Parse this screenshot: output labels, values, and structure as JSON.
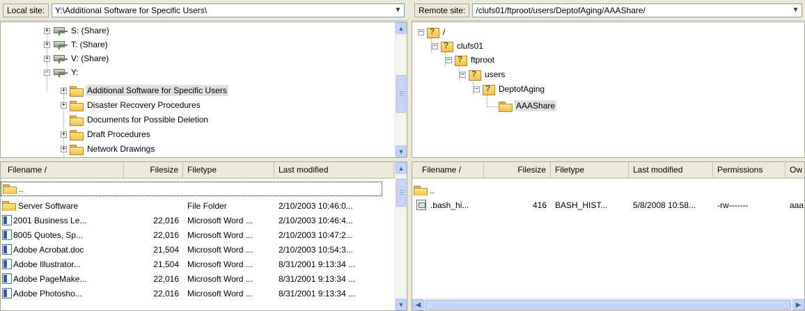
{
  "local": {
    "label": "Local site:",
    "path": "Y:\\Additional Software for Specific Users\\",
    "tree": [
      {
        "label": "S: (Share)",
        "type": "share",
        "expander": "+"
      },
      {
        "label": "T: (Share)",
        "type": "share",
        "expander": "+"
      },
      {
        "label": "V: (Share)",
        "type": "share",
        "expander": "+"
      },
      {
        "label": "Y:",
        "type": "share",
        "expander": "−"
      },
      {
        "label": "Additional Software for Specific Users",
        "type": "folder",
        "expander": "+",
        "selected": true
      },
      {
        "label": "Disaster Recovery Procedures",
        "type": "folder",
        "expander": "+"
      },
      {
        "label": "Documents for Possible Deletion",
        "type": "folder",
        "expander": ""
      },
      {
        "label": "Draft Procedures",
        "type": "folder",
        "expander": "+"
      },
      {
        "label": "Network Drawings",
        "type": "folder",
        "expander": "+"
      }
    ],
    "columns": [
      "Filename  /",
      "Filesize",
      "Filetype",
      "Last modified"
    ],
    "files": [
      {
        "name": "..",
        "size": "",
        "type": "",
        "modified": "",
        "icon": "folder"
      },
      {
        "name": "Server Software",
        "size": "",
        "type": "File Folder",
        "modified": "2/10/2003 10:46:0...",
        "icon": "folder"
      },
      {
        "name": "2001 Business Le...",
        "size": "22,016",
        "type": "Microsoft Word ...",
        "modified": "2/10/2003 10:46:4...",
        "icon": "word"
      },
      {
        "name": "8005 Quotes, Sp...",
        "size": "22,016",
        "type": "Microsoft Word ...",
        "modified": "2/10/2003 10:47:2...",
        "icon": "word"
      },
      {
        "name": "Adobe Acrobat.doc",
        "size": "21,504",
        "type": "Microsoft Word ...",
        "modified": "2/10/2003 10:54:3...",
        "icon": "word"
      },
      {
        "name": "Adobe Illustrator...",
        "size": "21,504",
        "type": "Microsoft Word ...",
        "modified": "8/31/2001 9:13:34 ...",
        "icon": "word"
      },
      {
        "name": "Adobe PageMake...",
        "size": "22,016",
        "type": "Microsoft Word ...",
        "modified": "8/31/2001 9:13:34 ...",
        "icon": "word"
      },
      {
        "name": "Adobe Photosho...",
        "size": "22,016",
        "type": "Microsoft Word ...",
        "modified": "8/31/2001 9:13:34 ...",
        "icon": "word"
      }
    ]
  },
  "remote": {
    "label": "Remote site:",
    "path": "/clufs01/ftproot/users/DeptofAging/AAAShare/",
    "tree": [
      {
        "label": "/",
        "expander": "−"
      },
      {
        "label": "clufs01",
        "expander": "−"
      },
      {
        "label": "ftproot",
        "expander": "−"
      },
      {
        "label": "users",
        "expander": "−"
      },
      {
        "label": "DeptofAging",
        "expander": "−"
      },
      {
        "label": "AAAShare",
        "expander": "",
        "selected": true
      }
    ],
    "columns": [
      "Filename  /",
      "Filesize",
      "Filetype",
      "Last modified",
      "Permissions",
      "Ow"
    ],
    "files": [
      {
        "name": "..",
        "size": "",
        "type": "",
        "modified": "",
        "perms": "",
        "owner": "",
        "icon": "folder"
      },
      {
        "name": ".bash_hi...",
        "size": "416",
        "type": "BASH_HIST...",
        "modified": "5/8/2008 10:58...",
        "perms": "-rw-------",
        "owner": "aaa",
        "icon": "file"
      }
    ]
  },
  "icons": {
    "combo_arrow": "chevron-down-icon",
    "scroll_up": "scroll-up-icon",
    "scroll_down": "scroll-down-icon",
    "scroll_left": "scroll-left-icon",
    "scroll_right": "scroll-right-icon"
  },
  "scroll_glyphs": {
    "up": "▲",
    "down": "▼",
    "left": "◀",
    "right": "▶",
    "combo": "▼"
  }
}
